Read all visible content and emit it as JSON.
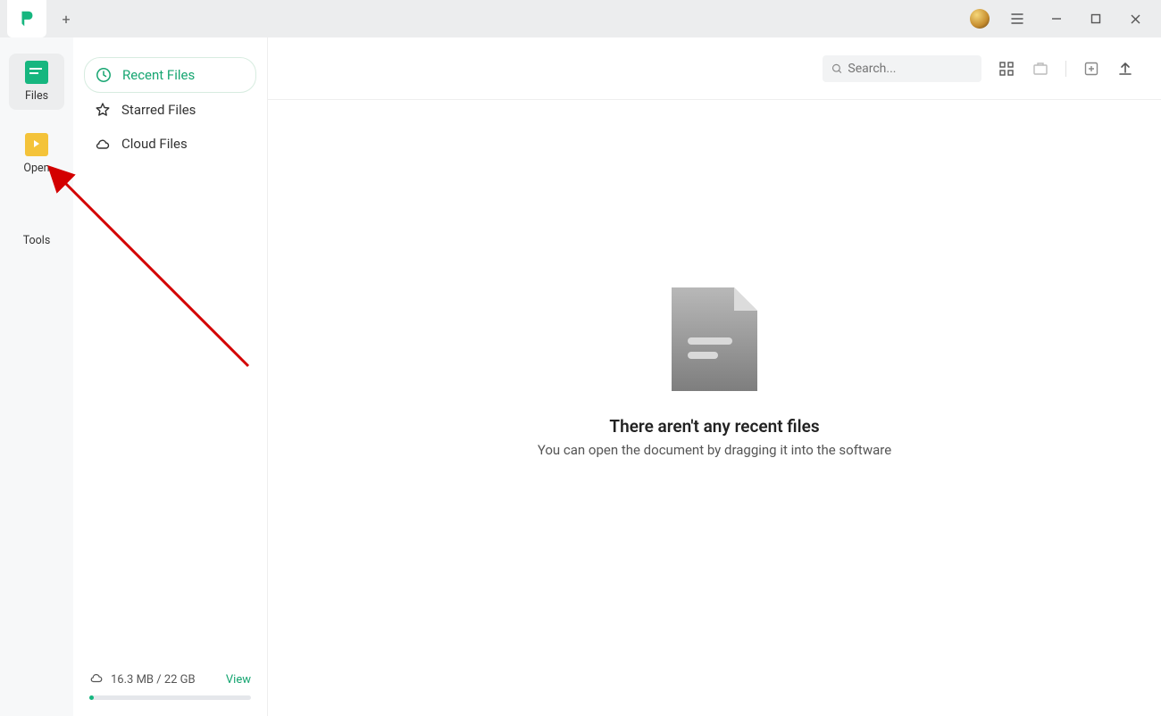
{
  "titlebar": {
    "new_tab_icon": "+"
  },
  "rail": {
    "items": [
      {
        "label": "Files"
      },
      {
        "label": "Open"
      },
      {
        "label": "Tools"
      }
    ]
  },
  "sidebar": {
    "items": [
      {
        "label": "Recent Files"
      },
      {
        "label": "Starred Files"
      },
      {
        "label": "Cloud Files"
      }
    ]
  },
  "storage": {
    "text": "16.3 MB / 22 GB",
    "view": "View"
  },
  "search": {
    "placeholder": "Search..."
  },
  "empty": {
    "title": "There aren't any recent files",
    "subtitle": "You can open the document by dragging it into the software"
  },
  "colors": {
    "accent": "#16a571"
  }
}
